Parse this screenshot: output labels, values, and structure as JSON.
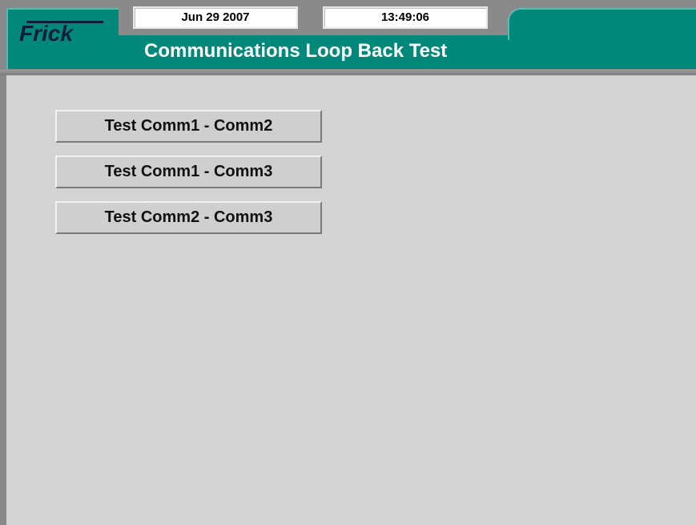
{
  "header": {
    "logo_text": "Frick",
    "date": "Jun 29 2007",
    "time": "13:49:06",
    "title": "Communications Loop Back Test"
  },
  "buttons": [
    {
      "label": "Test Comm1 - Comm2"
    },
    {
      "label": "Test Comm1 - Comm3"
    },
    {
      "label": "Test Comm2 - Comm3"
    }
  ],
  "colors": {
    "header_teal": "#00897b",
    "frame_grey": "#8a8a8a",
    "panel_grey": "#d4d4d4",
    "title_text": "#ffffff"
  }
}
